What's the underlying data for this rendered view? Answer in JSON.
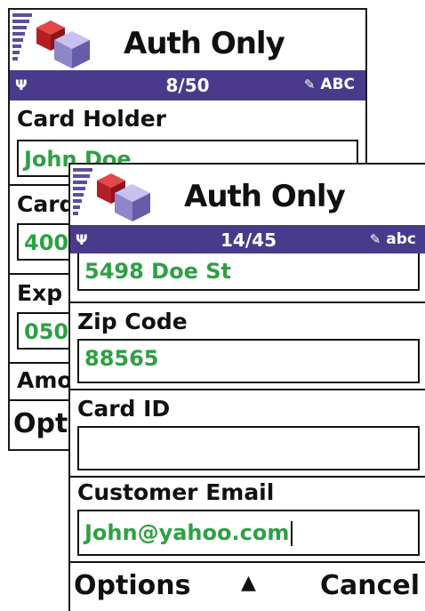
{
  "back_screen": {
    "title": "Auth Only",
    "status": {
      "counter": "8/50",
      "mode": "ABC"
    },
    "fields": [
      {
        "label": "Card Holder",
        "value": "John Doe"
      },
      {
        "label": "Card",
        "value": "400"
      },
      {
        "label": "Exp",
        "value": "050"
      },
      {
        "label": "Amo",
        "value": ""
      }
    ],
    "softkey_left": "Opti"
  },
  "front_screen": {
    "title": "Auth Only",
    "status": {
      "counter": "14/45",
      "mode": "abc"
    },
    "fields": [
      {
        "label": "",
        "value": "5498 Doe St"
      },
      {
        "label": "Zip Code",
        "value": "88565"
      },
      {
        "label": "Card ID",
        "value": ""
      },
      {
        "label": "Customer Email",
        "value": "John@yahoo.com"
      }
    ],
    "softkeys": {
      "left": "Options",
      "middle": "▲",
      "right": "Cancel"
    }
  },
  "colors": {
    "status_bar": "#4a3a8c",
    "input_text": "#2ea043",
    "icon_cube_red": "#c0282d",
    "icon_cube_purple": "#8f85c9"
  },
  "icons": {
    "app": "cube-icon",
    "antenna": "antenna-icon",
    "pen": "pen-icon"
  }
}
